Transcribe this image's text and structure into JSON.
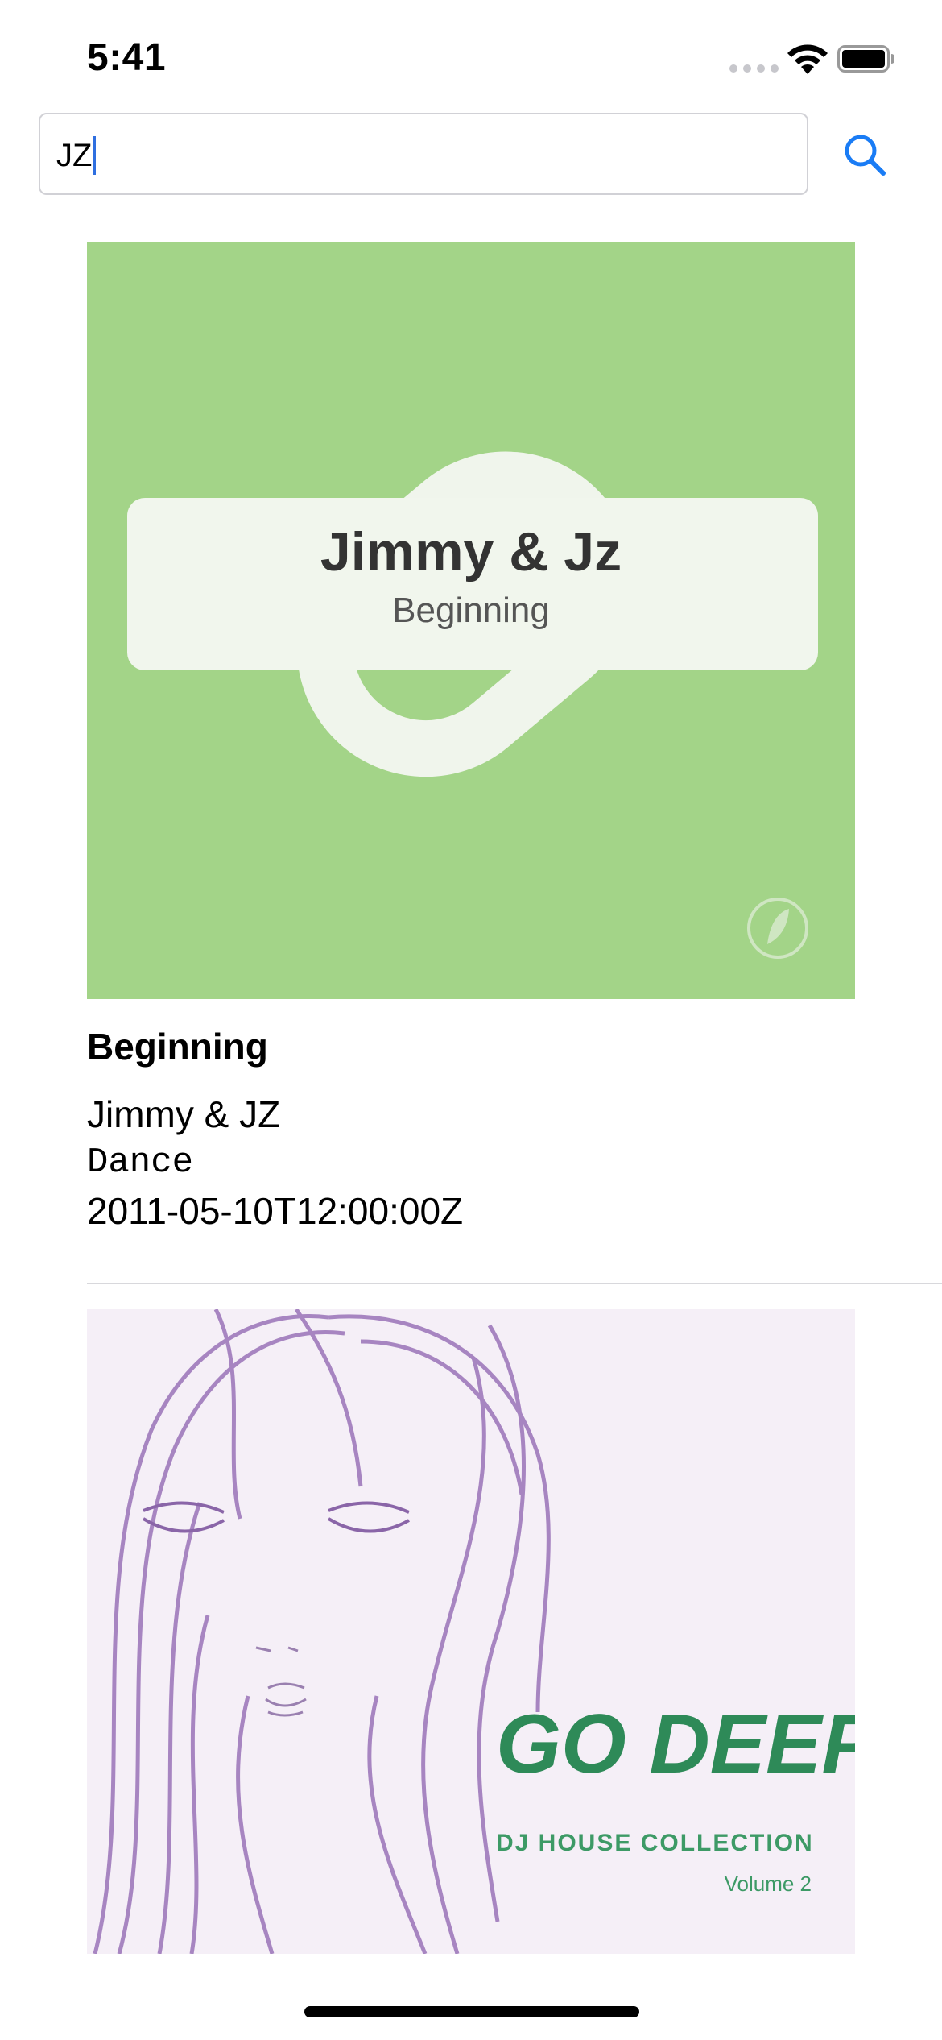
{
  "status_bar": {
    "time": "5:41",
    "icons": [
      "cellular-signal-icon",
      "wifi-icon",
      "battery-icon"
    ]
  },
  "search": {
    "value": "JZ",
    "placeholder": "",
    "button_icon": "search-icon",
    "accent_color": "#1a7cf5"
  },
  "results": [
    {
      "artwork": {
        "title_text": "Jimmy & Jz",
        "subtitle_text": "Beginning",
        "background_color": "#a3d488"
      },
      "track_name": "Beginning",
      "artist_name": "Jimmy & JZ",
      "genre": "Dance",
      "release_date": "2011-05-10T12:00:00Z"
    },
    {
      "artwork": {
        "title_text": "GO DEEP",
        "subtitle_text": "DJ HOUSE COLLECTION",
        "volume_text": "Volume 2",
        "background_color": "#f5eff7"
      }
    }
  ]
}
